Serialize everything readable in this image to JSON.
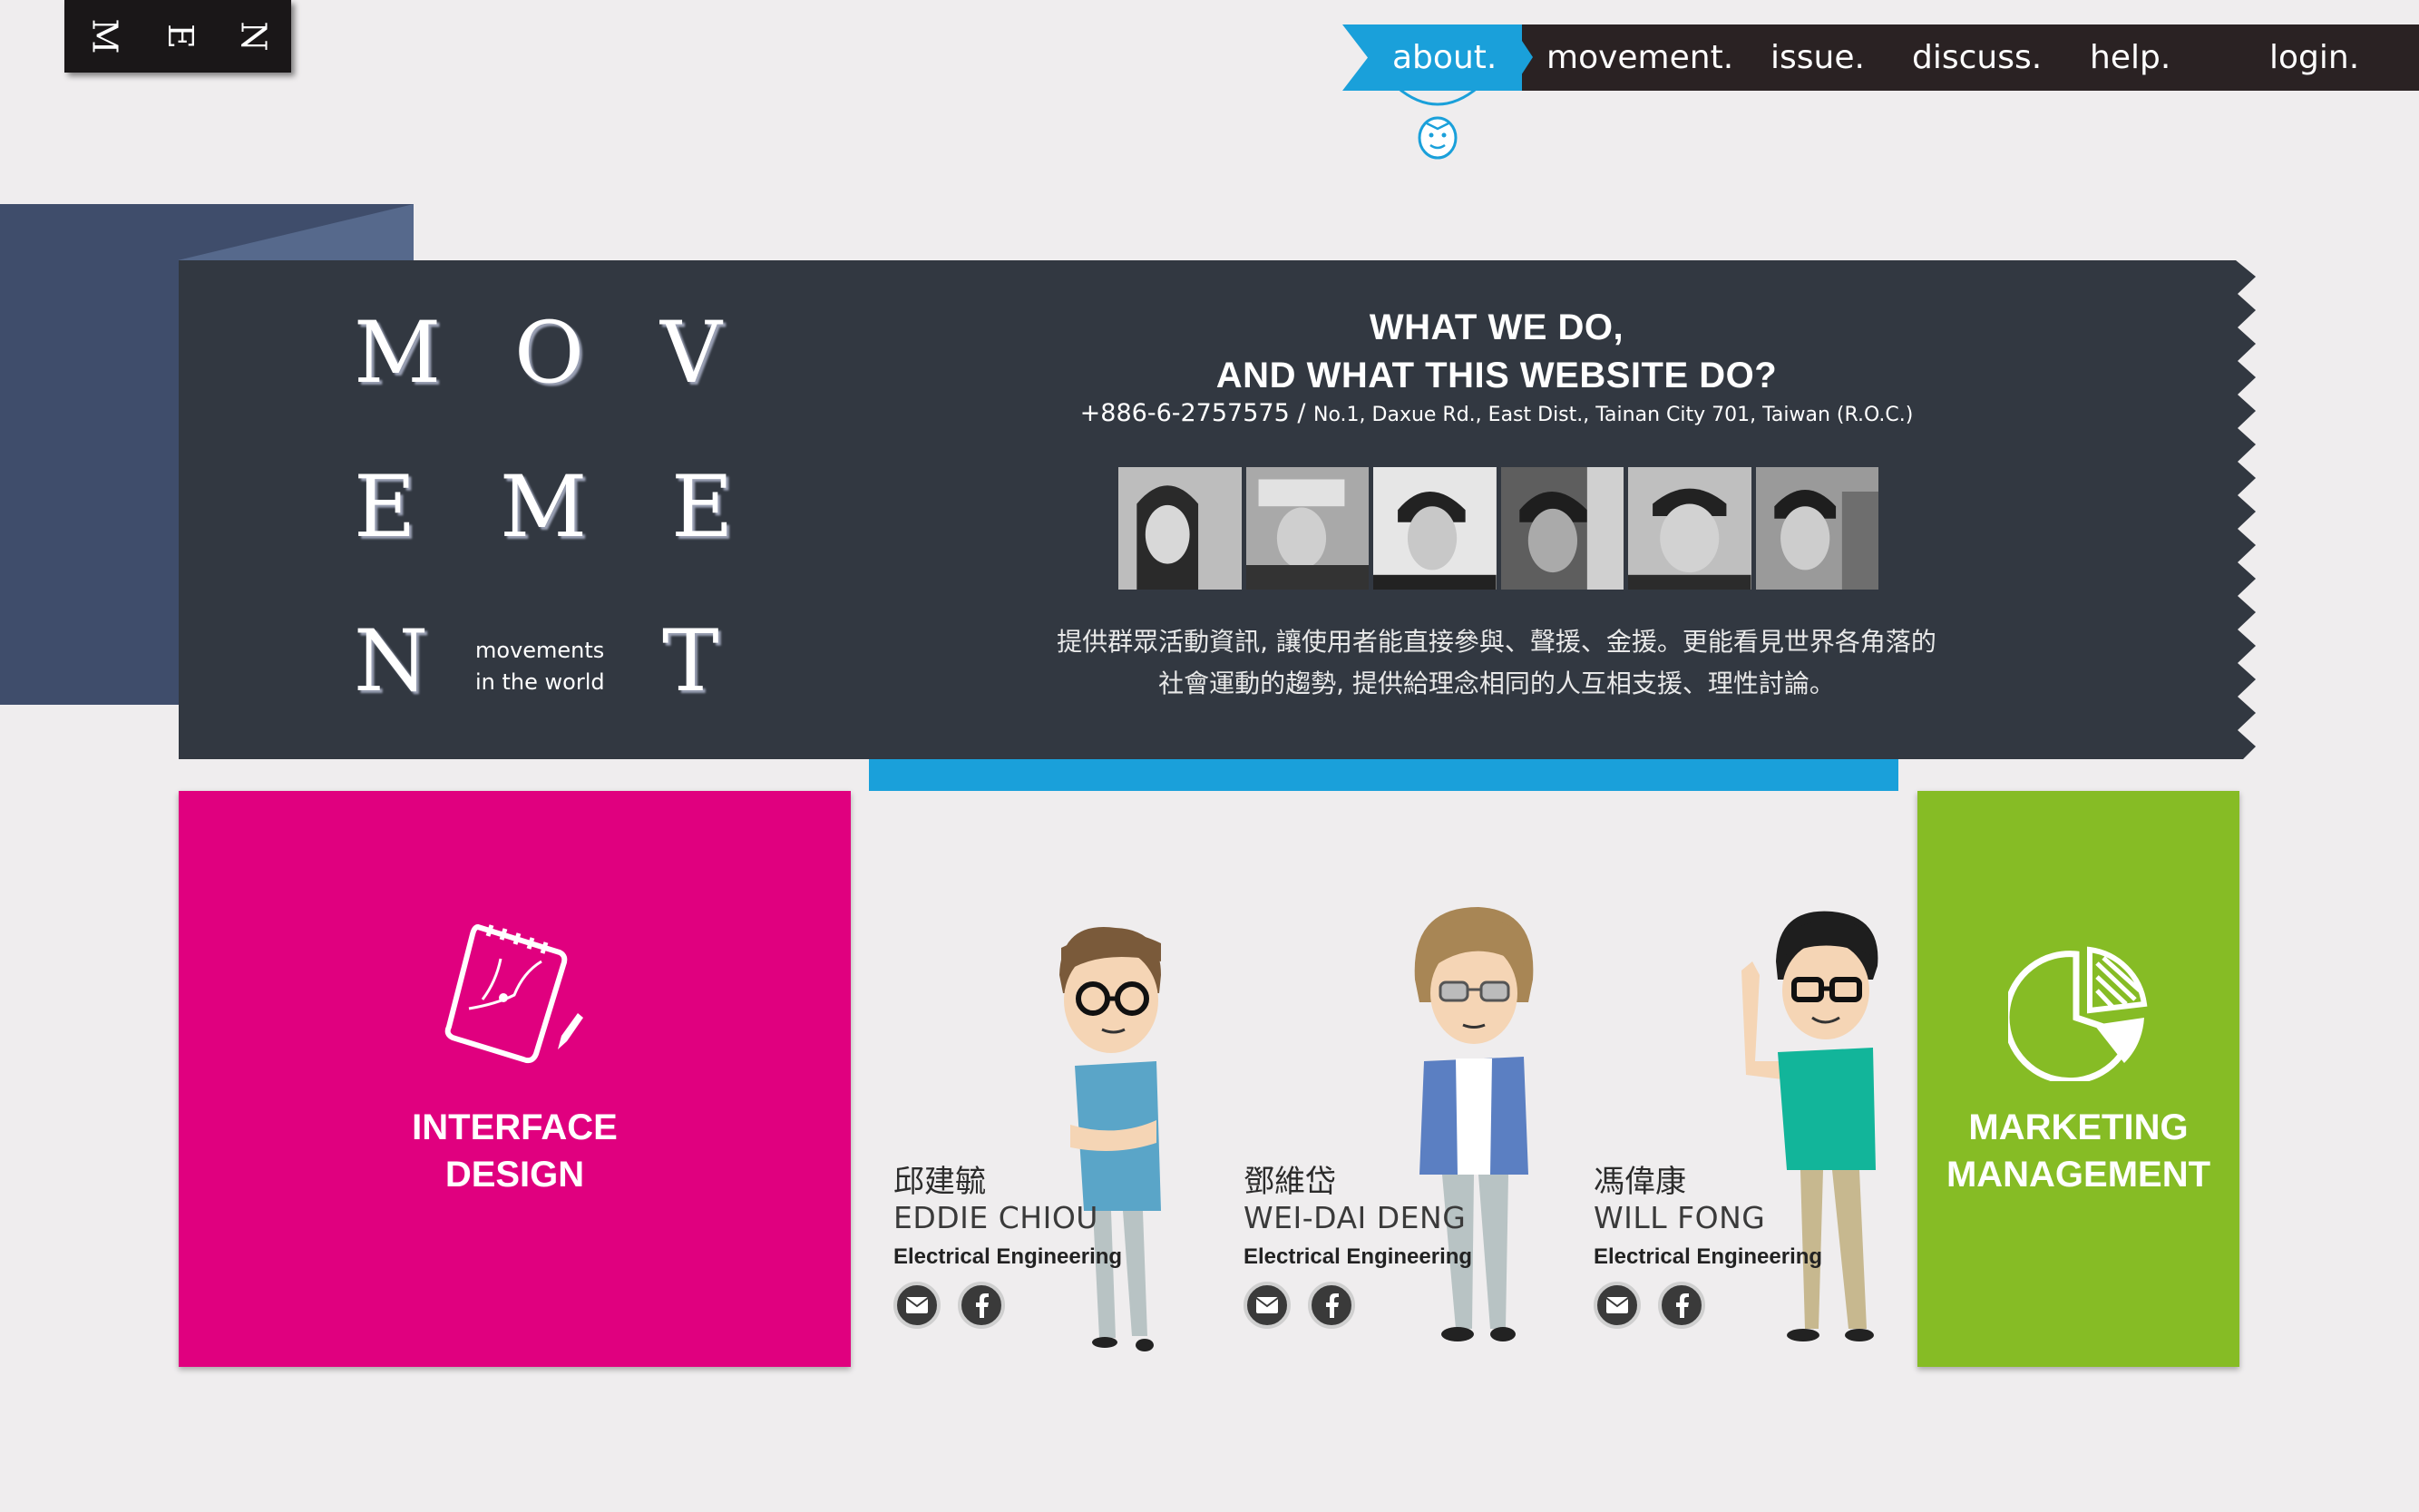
{
  "logo": {
    "letters": [
      "M",
      "E",
      "N"
    ]
  },
  "nav": {
    "about": "about.",
    "movement": "movement.",
    "issue": "issue.",
    "discuss": "discuss.",
    "help": "help.",
    "login": "login."
  },
  "hero": {
    "letters": [
      "M",
      "O",
      "V",
      "E",
      "M",
      "E",
      "N",
      "T"
    ],
    "tagline_line1": "movements",
    "tagline_line2": "in the world",
    "headline_line1": "WHAT WE DO,",
    "headline_line2": "AND WHAT THIS WEBSITE DO?",
    "phone": "+886-6-2757575",
    "separator": " / ",
    "address": "No.1, Daxue Rd., East Dist., Tainan City 701, Taiwan (R.O.C.)",
    "intro_line1": "提供群眾活動資訊, 讓使用者能直接參與、聲援、金援。更能看見世界各角落的",
    "intro_line2": "社會運動的趨勢, 提供給理念相同的人互相支援、理性討論。"
  },
  "tiles": {
    "interface_line1": "INTERFACE",
    "interface_line2": "DESIGN",
    "marketing_line1": "MARKETING",
    "marketing_line2": "MANAGEMENT"
  },
  "team": [
    {
      "name_cn": "邱建毓",
      "name_en": "EDDIE CHIOU",
      "dept": "Electrical Engineering",
      "shirt": "#5aa5c8"
    },
    {
      "name_cn": "鄧維岱",
      "name_en": "WEI-DAI DENG",
      "dept": "Electrical Engineering",
      "shirt": "#5b7fc2"
    },
    {
      "name_cn": "馮偉康",
      "name_en": "WILL FONG",
      "dept": "Electrical Engineering",
      "shirt": "#12b59a"
    }
  ],
  "colors": {
    "accent": "#1aa0da",
    "pink": "#e0007f",
    "green": "#86bc25",
    "dark": "#323841",
    "navy": "#3f4d6b"
  }
}
